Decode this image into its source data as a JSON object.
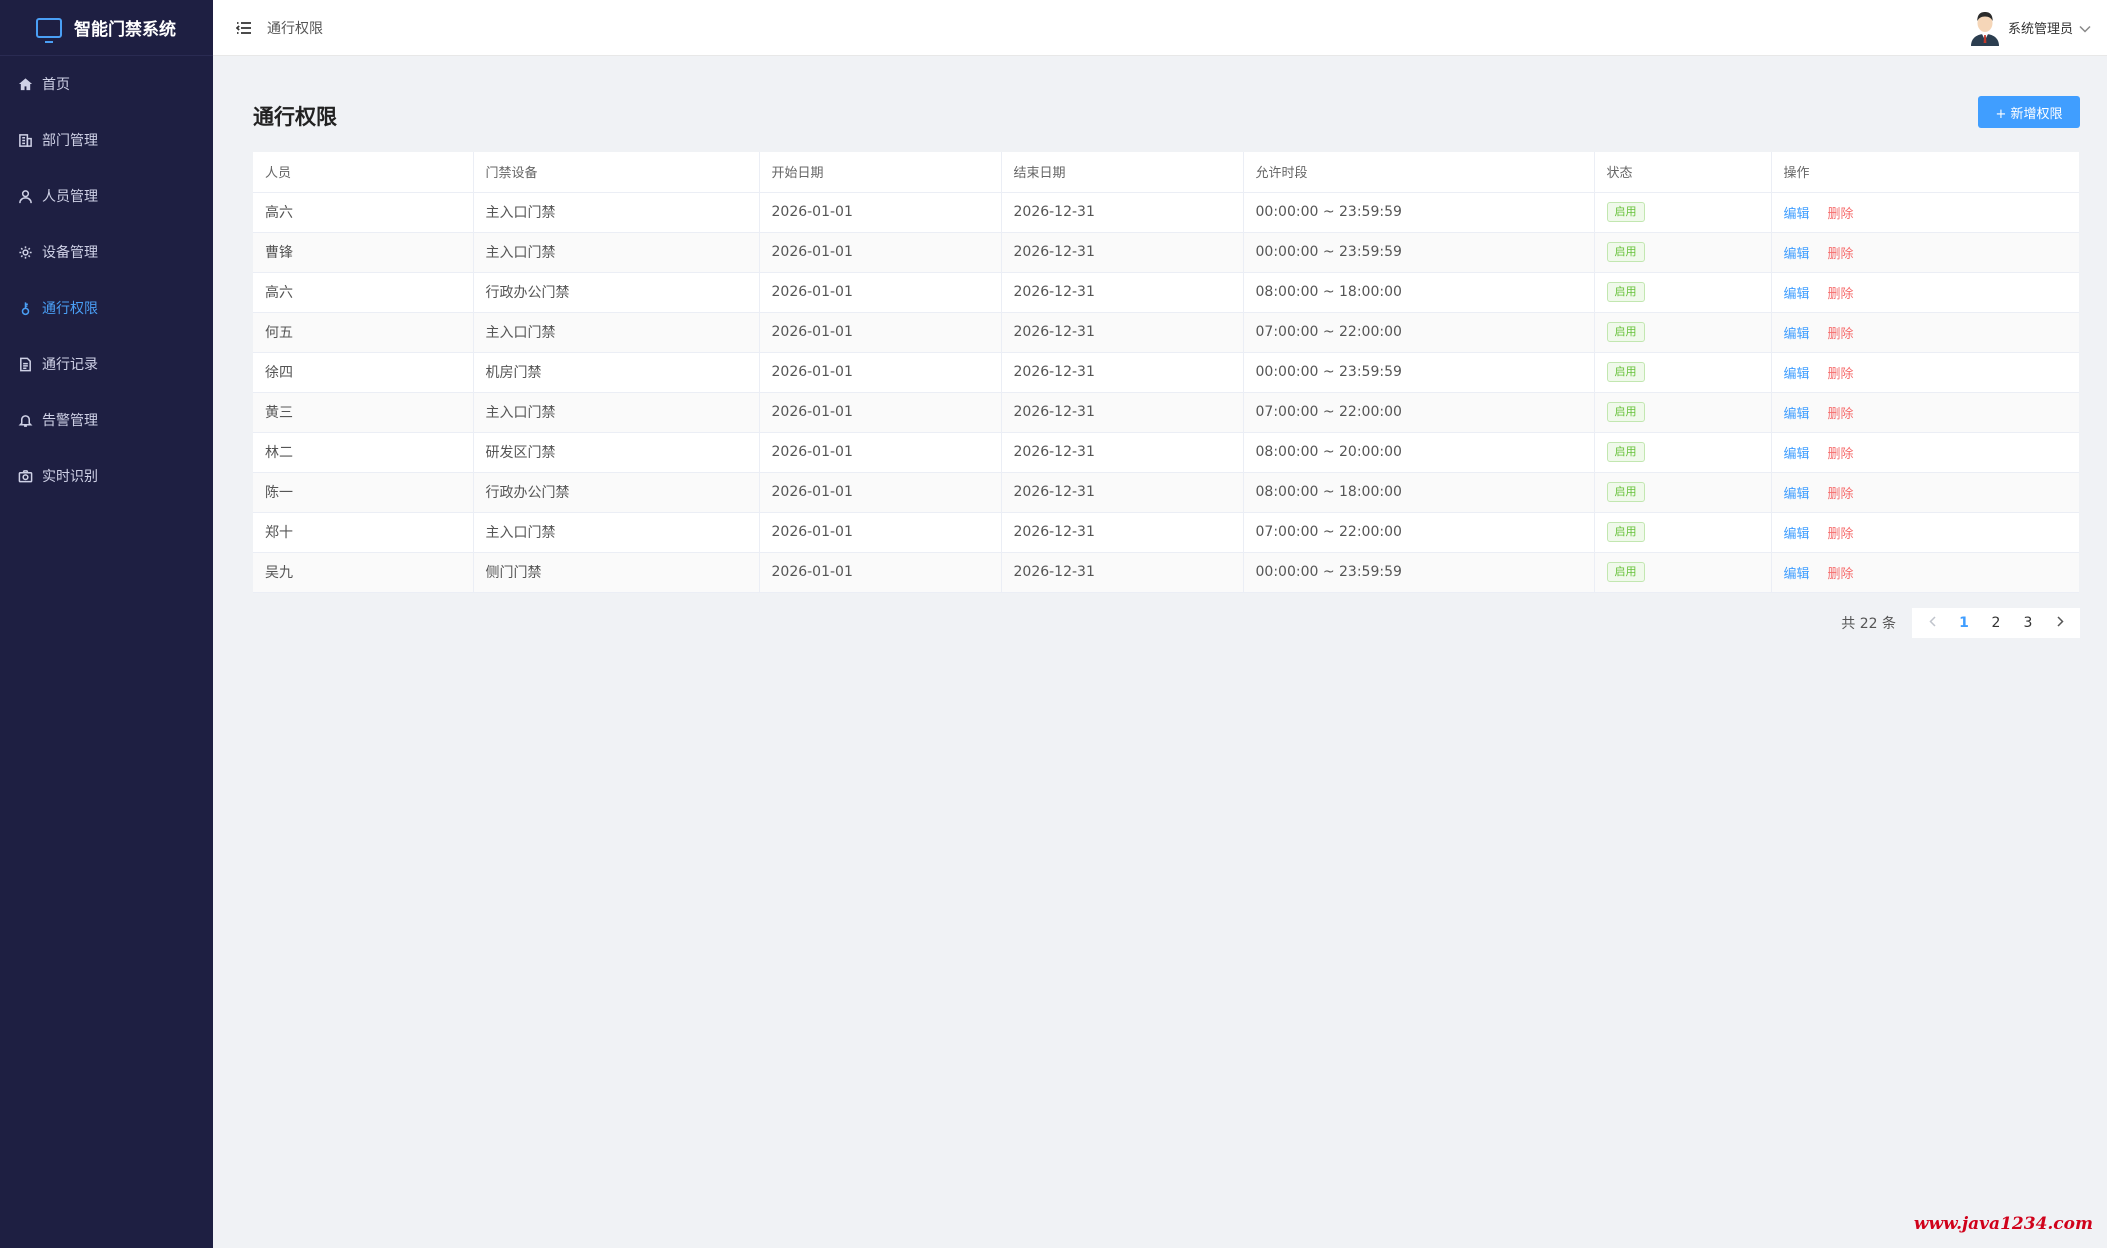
{
  "brand": {
    "title": "智能门禁系统"
  },
  "sidebar": {
    "items": [
      {
        "label": "首页",
        "icon": "home-icon"
      },
      {
        "label": "部门管理",
        "icon": "building-icon"
      },
      {
        "label": "人员管理",
        "icon": "user-icon"
      },
      {
        "label": "设备管理",
        "icon": "gear-icon"
      },
      {
        "label": "通行权限",
        "icon": "key-icon",
        "active": true
      },
      {
        "label": "通行记录",
        "icon": "document-icon"
      },
      {
        "label": "告警管理",
        "icon": "bell-icon"
      },
      {
        "label": "实时识别",
        "icon": "camera-icon"
      }
    ]
  },
  "header": {
    "breadcrumb": "通行权限",
    "user_name": "系统管理员"
  },
  "page": {
    "title": "通行权限",
    "add_button": "+ 新增权限"
  },
  "table": {
    "columns": [
      "人员",
      "门禁设备",
      "开始日期",
      "结束日期",
      "允许时段",
      "状态",
      "操作"
    ],
    "edit_label": "编辑",
    "delete_label": "删除",
    "rows": [
      {
        "person": "高六",
        "device": "主入口门禁",
        "start": "2026-01-01",
        "end": "2026-12-31",
        "period": "00:00:00 ~ 23:59:59",
        "status": "启用"
      },
      {
        "person": "曹锋",
        "device": "主入口门禁",
        "start": "2026-01-01",
        "end": "2026-12-31",
        "period": "00:00:00 ~ 23:59:59",
        "status": "启用"
      },
      {
        "person": "高六",
        "device": "行政办公门禁",
        "start": "2026-01-01",
        "end": "2026-12-31",
        "period": "08:00:00 ~ 18:00:00",
        "status": "启用"
      },
      {
        "person": "何五",
        "device": "主入口门禁",
        "start": "2026-01-01",
        "end": "2026-12-31",
        "period": "07:00:00 ~ 22:00:00",
        "status": "启用"
      },
      {
        "person": "徐四",
        "device": "机房门禁",
        "start": "2026-01-01",
        "end": "2026-12-31",
        "period": "00:00:00 ~ 23:59:59",
        "status": "启用"
      },
      {
        "person": "黄三",
        "device": "主入口门禁",
        "start": "2026-01-01",
        "end": "2026-12-31",
        "period": "07:00:00 ~ 22:00:00",
        "status": "启用"
      },
      {
        "person": "林二",
        "device": "研发区门禁",
        "start": "2026-01-01",
        "end": "2026-12-31",
        "period": "08:00:00 ~ 20:00:00",
        "status": "启用"
      },
      {
        "person": "陈一",
        "device": "行政办公门禁",
        "start": "2026-01-01",
        "end": "2026-12-31",
        "period": "08:00:00 ~ 18:00:00",
        "status": "启用"
      },
      {
        "person": "郑十",
        "device": "主入口门禁",
        "start": "2026-01-01",
        "end": "2026-12-31",
        "period": "07:00:00 ~ 22:00:00",
        "status": "启用"
      },
      {
        "person": "吴九",
        "device": "侧门门禁",
        "start": "2026-01-01",
        "end": "2026-12-31",
        "period": "00:00:00 ~ 23:59:59",
        "status": "启用"
      }
    ]
  },
  "pagination": {
    "total_label": "共 22 条",
    "pages": [
      "1",
      "2",
      "3"
    ],
    "current": "1"
  },
  "watermark": "www.java1234.com",
  "colors": {
    "sidebar_bg": "#1e1f42",
    "accent": "#409eff",
    "success": "#67c23a",
    "danger": "#f56c6c"
  }
}
